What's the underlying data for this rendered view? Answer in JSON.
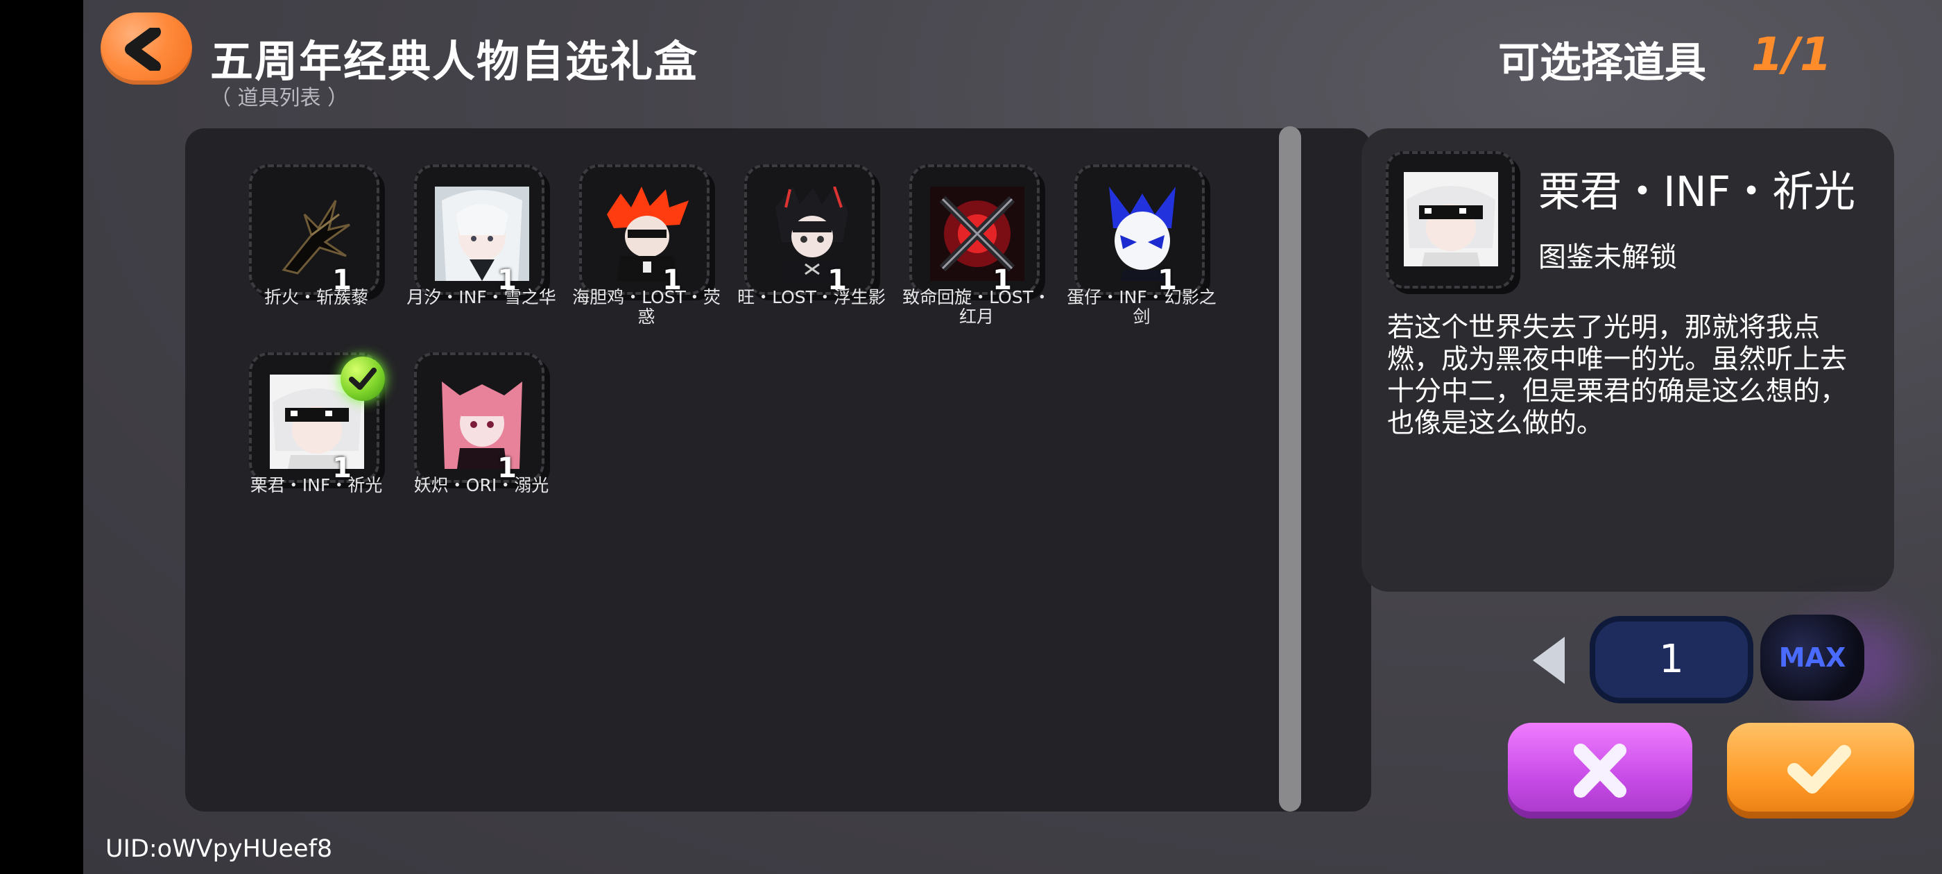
{
  "header": {
    "title": "五周年经典人物自选礼盒",
    "subtitle": "（ 道具列表 ）",
    "selectable_label": "可选择道具",
    "selectable_count": "1/1"
  },
  "items": [
    {
      "name": "折火・斩蔟藜",
      "qty": "1",
      "icon": "black-spiky-weapon-icon",
      "selected": false
    },
    {
      "name": "月汐・INF・雪之华",
      "qty": "1",
      "icon": "white-hair-girl-portrait-icon",
      "selected": false
    },
    {
      "name": "海胆鸡・LOST・荧惑",
      "qty": "1",
      "icon": "red-hair-character-portrait-icon",
      "selected": false
    },
    {
      "name": "旺・LOST・浮生影",
      "qty": "1",
      "icon": "dark-hair-character-portrait-icon",
      "selected": false
    },
    {
      "name": "致命回旋・LOST・红月",
      "qty": "1",
      "icon": "red-crossed-blades-icon",
      "selected": false
    },
    {
      "name": "蛋仔・INF・幻影之剑",
      "qty": "1",
      "icon": "blue-white-mask-portrait-icon",
      "selected": false
    },
    {
      "name": "栗君・INF・祈光",
      "qty": "1",
      "icon": "white-hair-sunglasses-portrait-icon",
      "selected": true
    },
    {
      "name": "妖炽・ORI・溺光",
      "qty": "1",
      "icon": "pink-hair-girl-portrait-icon",
      "selected": false
    }
  ],
  "detail": {
    "name": "栗君・INF・祈光",
    "status": "图鉴未解锁",
    "description": "若这个世界失去了光明，那就将我点燃，成为黑夜中唯一的光。虽然听上去十分中二，但是栗君的确是这么想的，也像是这么做的。"
  },
  "quantity": {
    "value": "1",
    "max_label": "MAX"
  },
  "footer": {
    "uid": "UID:oWVpyHUeef8"
  },
  "colors": {
    "accent_orange": "#ff8c2a",
    "cancel_purple": "#c64ae6",
    "confirm_orange": "#ff9a28",
    "selected_green": "#7fd42a"
  }
}
